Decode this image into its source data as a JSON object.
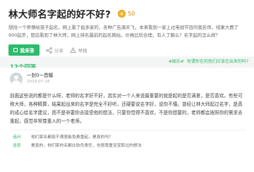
{
  "question": {
    "title": "林大师名字起的好不好?",
    "reward": "50",
    "description": "想找一个师傅给孩子起名，网上看了挺多家的，各种广告满天飞，本来看到一家上过电视节目的我名师，结果大费了900起步，怒后看到了林大师，网上排名最前的起名网站，价格比较合理，有人了解么？名字起的怎么样？",
    "answer_button": "我来答",
    "actions": [
      {
        "icon": "share-icon",
        "label": "分享"
      },
      {
        "icon": "report-icon",
        "label": "举报"
      }
    ],
    "icon_color": "#f5b731"
  },
  "banner": {
    "tag": "#娱乐#",
    "text": "何谓你在的我们应该在出来的吗?"
  },
  "answers_header": {
    "count_label": "12个回答"
  },
  "answer": {
    "user_name": "一封0一首耀",
    "date": "2019-07-16",
    "body": "前面这些说的都是什么呀，老师的名字好不好，其实对一个人来说最重要的就是起的是否满意，是否喜欢。有些可称大师，各种精算，结果起出来的名字是完全不好听，还硬要说名字好，说你不懂。曾经让林大师起过名字，是真的成心给名字建议，而不是非要你去接受他的想法，只要你觉得不喜欢，不是你想要的，老师都会按照你的需求去重起，感觉非常尊重人的一个老师。",
    "comments": [
      {
        "label": "追问",
        "text": "他们家名都挺不满意能免费重起，是真的吗？"
      },
      {
        "label": "追答",
        "text": "是真的，他们家的名都比较负责任，也很尊重宝宝取过的想法"
      }
    ]
  },
  "colors": {
    "brand_green": "#2dbb6b",
    "coin": "#f5b731"
  }
}
